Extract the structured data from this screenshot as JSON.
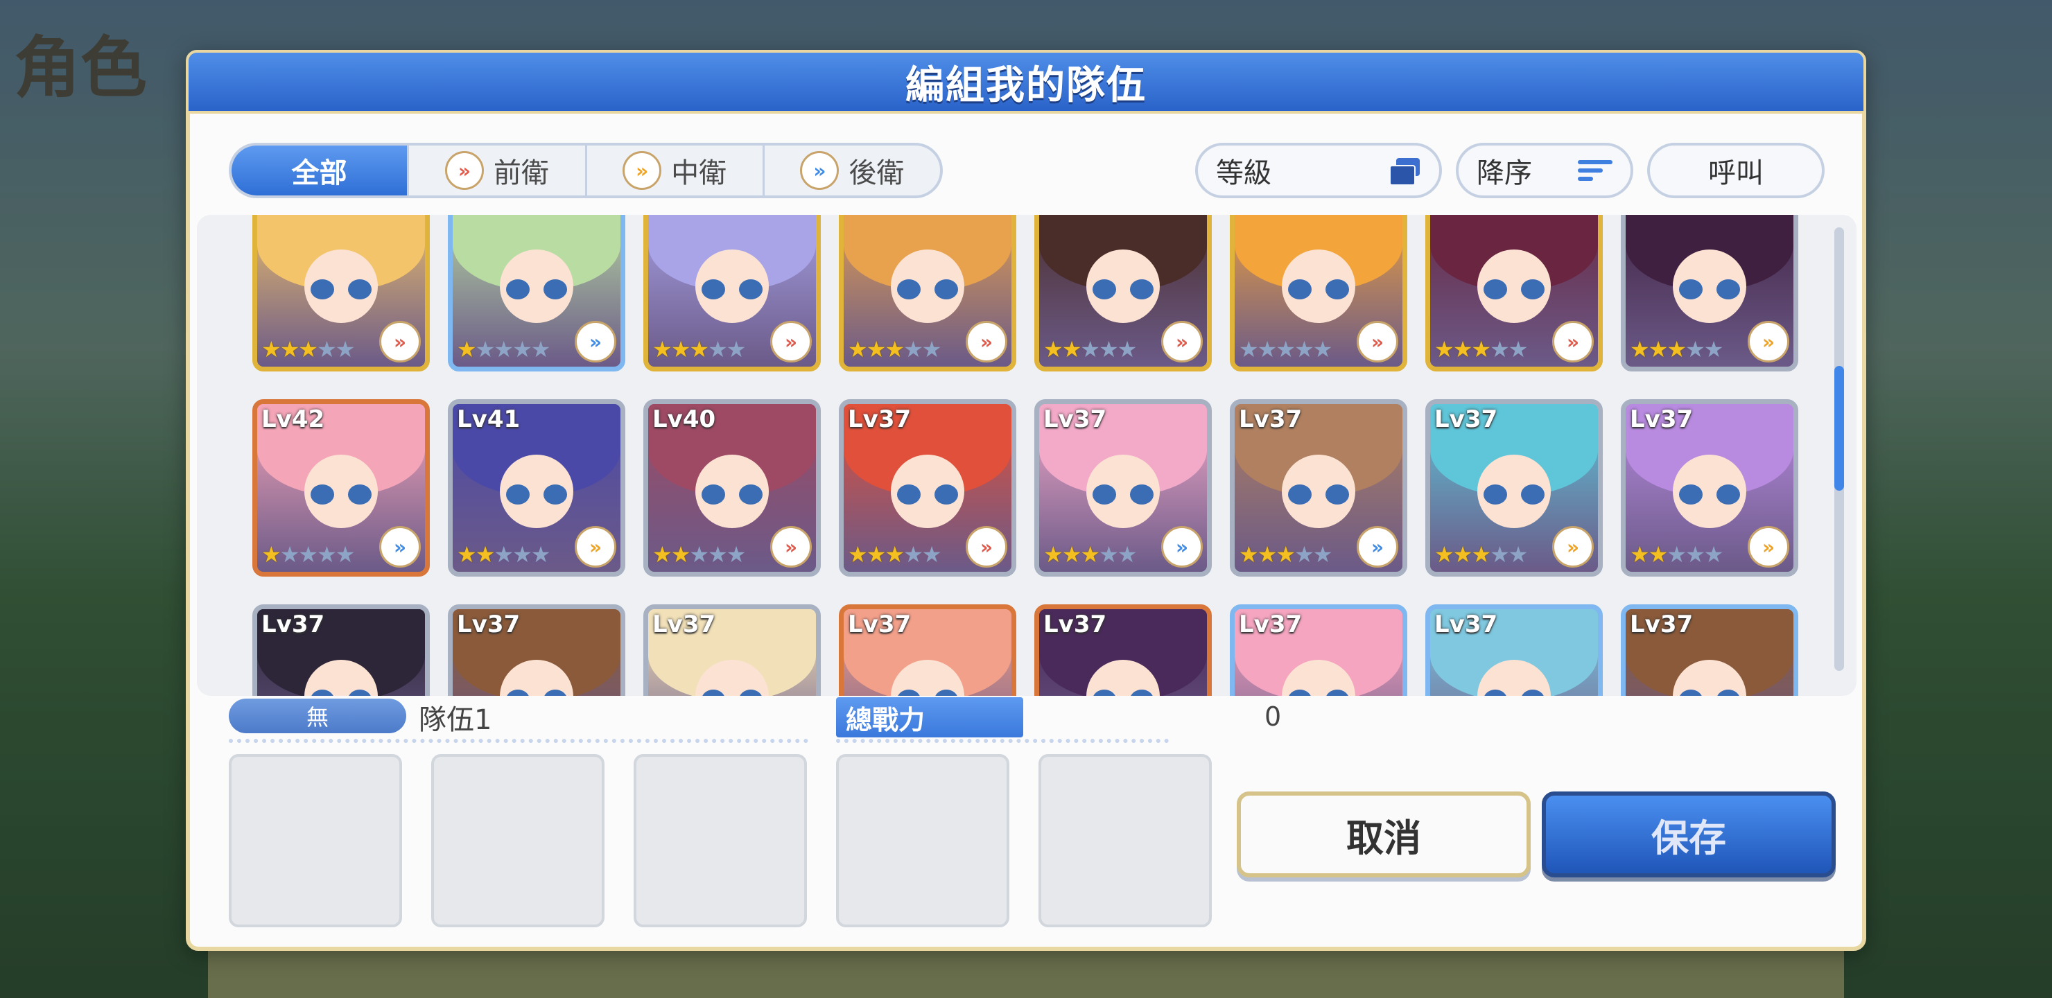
{
  "background": {
    "title": "角色"
  },
  "modal": {
    "title": "編組我的隊伍"
  },
  "filters": {
    "tabs": [
      {
        "label": "全部",
        "icon": null
      },
      {
        "label": "前衛",
        "icon": "front-position-icon"
      },
      {
        "label": "中衛",
        "icon": "middle-position-icon"
      },
      {
        "label": "後衛",
        "icon": "back-position-icon"
      }
    ],
    "level_button": "等級",
    "sort_button": "降序",
    "call_button": "呼叫"
  },
  "characters": [
    {
      "level": "",
      "stars": 3,
      "position": "front",
      "rarity": "gold",
      "hair": "#f3c46a"
    },
    {
      "level": "",
      "stars": 1,
      "position": "back",
      "rarity": "blue",
      "hair": "#b9dca2"
    },
    {
      "level": "",
      "stars": 3,
      "position": "front",
      "rarity": "gold",
      "hair": "#a9a4e8"
    },
    {
      "level": "",
      "stars": 3,
      "position": "front",
      "rarity": "gold",
      "hair": "#e8a24d"
    },
    {
      "level": "",
      "stars": 2,
      "position": "front",
      "rarity": "gold",
      "hair": "#4a2c28"
    },
    {
      "level": "",
      "stars": 0,
      "position": "front",
      "rarity": "gold",
      "hair": "#f3a43a"
    },
    {
      "level": "",
      "stars": 3,
      "position": "front",
      "rarity": "gold",
      "hair": "#6a2540"
    },
    {
      "level": "",
      "stars": 3,
      "position": "middle",
      "rarity": "silver",
      "hair": "#402040"
    },
    {
      "level": "Lv42",
      "stars": 1,
      "position": "back",
      "rarity": "copper",
      "hair": "#f5a5b8"
    },
    {
      "level": "Lv41",
      "stars": 2,
      "position": "middle",
      "rarity": "silver",
      "hair": "#4b49a8"
    },
    {
      "level": "Lv40",
      "stars": 2,
      "position": "front",
      "rarity": "silver",
      "hair": "#9e4a64"
    },
    {
      "level": "Lv37",
      "stars": 3,
      "position": "front",
      "rarity": "silver",
      "hair": "#e0503a"
    },
    {
      "level": "Lv37",
      "stars": 3,
      "position": "back",
      "rarity": "silver",
      "hair": "#f3a9c8"
    },
    {
      "level": "Lv37",
      "stars": 3,
      "position": "back",
      "rarity": "silver",
      "hair": "#b08060"
    },
    {
      "level": "Lv37",
      "stars": 3,
      "position": "middle",
      "rarity": "silver",
      "hair": "#5fc5d8"
    },
    {
      "level": "Lv37",
      "stars": 2,
      "position": "middle",
      "rarity": "silver",
      "hair": "#b88ae0"
    },
    {
      "level": "Lv37",
      "stars": 0,
      "position": "",
      "rarity": "silver",
      "hair": "#2c2638"
    },
    {
      "level": "Lv37",
      "stars": 0,
      "position": "",
      "rarity": "silver",
      "hair": "#8a5a3a"
    },
    {
      "level": "Lv37",
      "stars": 0,
      "position": "",
      "rarity": "silver",
      "hair": "#f1e0b8"
    },
    {
      "level": "Lv37",
      "stars": 0,
      "position": "",
      "rarity": "copper",
      "hair": "#f3a08a"
    },
    {
      "level": "Lv37",
      "stars": 0,
      "position": "",
      "rarity": "copper",
      "hair": "#4a2a5a"
    },
    {
      "level": "Lv37",
      "stars": 0,
      "position": "",
      "rarity": "blue",
      "hair": "#f5a5c0"
    },
    {
      "level": "Lv37",
      "stars": 0,
      "position": "",
      "rarity": "blue",
      "hair": "#7fc8e0"
    },
    {
      "level": "Lv37",
      "stars": 0,
      "position": "",
      "rarity": "blue",
      "hair": "#8a5a3a"
    }
  ],
  "team": {
    "attribute": "無",
    "name": "隊伍1",
    "power_label": "總戰力",
    "power_value": "0",
    "slots": 5
  },
  "buttons": {
    "cancel": "取消",
    "save": "保存"
  },
  "colors": {
    "header": "#2a63c9",
    "accent_gold": "#e0b43a",
    "save": "#1f56b8"
  }
}
